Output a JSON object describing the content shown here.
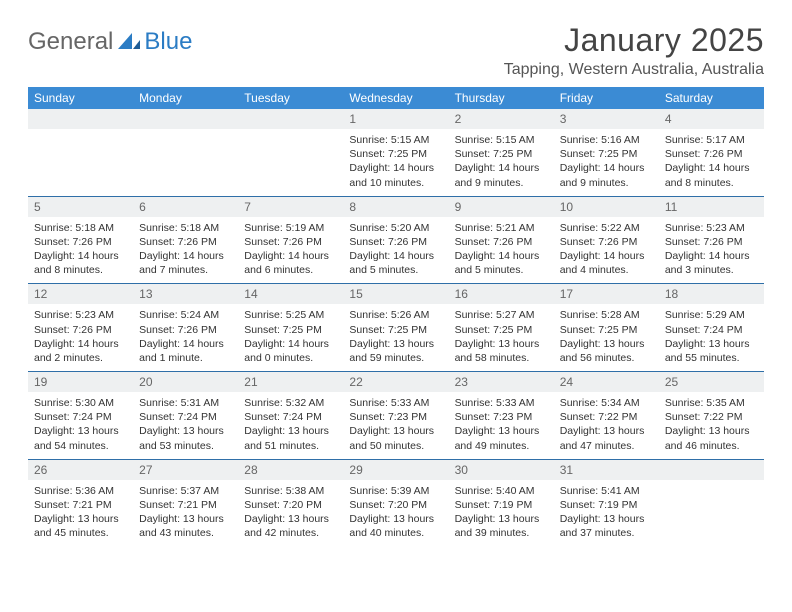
{
  "logo": {
    "part1": "General",
    "part2": "Blue"
  },
  "title": "January 2025",
  "location": "Tapping, Western Australia, Australia",
  "weekdays": [
    "Sunday",
    "Monday",
    "Tuesday",
    "Wednesday",
    "Thursday",
    "Friday",
    "Saturday"
  ],
  "weeks": [
    {
      "nums": [
        "",
        "",
        "",
        "1",
        "2",
        "3",
        "4"
      ],
      "cells": [
        null,
        null,
        null,
        {
          "sr": "Sunrise: 5:15 AM",
          "ss": "Sunset: 7:25 PM",
          "d1": "Daylight: 14 hours",
          "d2": "and 10 minutes."
        },
        {
          "sr": "Sunrise: 5:15 AM",
          "ss": "Sunset: 7:25 PM",
          "d1": "Daylight: 14 hours",
          "d2": "and 9 minutes."
        },
        {
          "sr": "Sunrise: 5:16 AM",
          "ss": "Sunset: 7:25 PM",
          "d1": "Daylight: 14 hours",
          "d2": "and 9 minutes."
        },
        {
          "sr": "Sunrise: 5:17 AM",
          "ss": "Sunset: 7:26 PM",
          "d1": "Daylight: 14 hours",
          "d2": "and 8 minutes."
        }
      ]
    },
    {
      "nums": [
        "5",
        "6",
        "7",
        "8",
        "9",
        "10",
        "11"
      ],
      "cells": [
        {
          "sr": "Sunrise: 5:18 AM",
          "ss": "Sunset: 7:26 PM",
          "d1": "Daylight: 14 hours",
          "d2": "and 8 minutes."
        },
        {
          "sr": "Sunrise: 5:18 AM",
          "ss": "Sunset: 7:26 PM",
          "d1": "Daylight: 14 hours",
          "d2": "and 7 minutes."
        },
        {
          "sr": "Sunrise: 5:19 AM",
          "ss": "Sunset: 7:26 PM",
          "d1": "Daylight: 14 hours",
          "d2": "and 6 minutes."
        },
        {
          "sr": "Sunrise: 5:20 AM",
          "ss": "Sunset: 7:26 PM",
          "d1": "Daylight: 14 hours",
          "d2": "and 5 minutes."
        },
        {
          "sr": "Sunrise: 5:21 AM",
          "ss": "Sunset: 7:26 PM",
          "d1": "Daylight: 14 hours",
          "d2": "and 5 minutes."
        },
        {
          "sr": "Sunrise: 5:22 AM",
          "ss": "Sunset: 7:26 PM",
          "d1": "Daylight: 14 hours",
          "d2": "and 4 minutes."
        },
        {
          "sr": "Sunrise: 5:23 AM",
          "ss": "Sunset: 7:26 PM",
          "d1": "Daylight: 14 hours",
          "d2": "and 3 minutes."
        }
      ]
    },
    {
      "nums": [
        "12",
        "13",
        "14",
        "15",
        "16",
        "17",
        "18"
      ],
      "cells": [
        {
          "sr": "Sunrise: 5:23 AM",
          "ss": "Sunset: 7:26 PM",
          "d1": "Daylight: 14 hours",
          "d2": "and 2 minutes."
        },
        {
          "sr": "Sunrise: 5:24 AM",
          "ss": "Sunset: 7:26 PM",
          "d1": "Daylight: 14 hours",
          "d2": "and 1 minute."
        },
        {
          "sr": "Sunrise: 5:25 AM",
          "ss": "Sunset: 7:25 PM",
          "d1": "Daylight: 14 hours",
          "d2": "and 0 minutes."
        },
        {
          "sr": "Sunrise: 5:26 AM",
          "ss": "Sunset: 7:25 PM",
          "d1": "Daylight: 13 hours",
          "d2": "and 59 minutes."
        },
        {
          "sr": "Sunrise: 5:27 AM",
          "ss": "Sunset: 7:25 PM",
          "d1": "Daylight: 13 hours",
          "d2": "and 58 minutes."
        },
        {
          "sr": "Sunrise: 5:28 AM",
          "ss": "Sunset: 7:25 PM",
          "d1": "Daylight: 13 hours",
          "d2": "and 56 minutes."
        },
        {
          "sr": "Sunrise: 5:29 AM",
          "ss": "Sunset: 7:24 PM",
          "d1": "Daylight: 13 hours",
          "d2": "and 55 minutes."
        }
      ]
    },
    {
      "nums": [
        "19",
        "20",
        "21",
        "22",
        "23",
        "24",
        "25"
      ],
      "cells": [
        {
          "sr": "Sunrise: 5:30 AM",
          "ss": "Sunset: 7:24 PM",
          "d1": "Daylight: 13 hours",
          "d2": "and 54 minutes."
        },
        {
          "sr": "Sunrise: 5:31 AM",
          "ss": "Sunset: 7:24 PM",
          "d1": "Daylight: 13 hours",
          "d2": "and 53 minutes."
        },
        {
          "sr": "Sunrise: 5:32 AM",
          "ss": "Sunset: 7:24 PM",
          "d1": "Daylight: 13 hours",
          "d2": "and 51 minutes."
        },
        {
          "sr": "Sunrise: 5:33 AM",
          "ss": "Sunset: 7:23 PM",
          "d1": "Daylight: 13 hours",
          "d2": "and 50 minutes."
        },
        {
          "sr": "Sunrise: 5:33 AM",
          "ss": "Sunset: 7:23 PM",
          "d1": "Daylight: 13 hours",
          "d2": "and 49 minutes."
        },
        {
          "sr": "Sunrise: 5:34 AM",
          "ss": "Sunset: 7:22 PM",
          "d1": "Daylight: 13 hours",
          "d2": "and 47 minutes."
        },
        {
          "sr": "Sunrise: 5:35 AM",
          "ss": "Sunset: 7:22 PM",
          "d1": "Daylight: 13 hours",
          "d2": "and 46 minutes."
        }
      ]
    },
    {
      "nums": [
        "26",
        "27",
        "28",
        "29",
        "30",
        "31",
        ""
      ],
      "cells": [
        {
          "sr": "Sunrise: 5:36 AM",
          "ss": "Sunset: 7:21 PM",
          "d1": "Daylight: 13 hours",
          "d2": "and 45 minutes."
        },
        {
          "sr": "Sunrise: 5:37 AM",
          "ss": "Sunset: 7:21 PM",
          "d1": "Daylight: 13 hours",
          "d2": "and 43 minutes."
        },
        {
          "sr": "Sunrise: 5:38 AM",
          "ss": "Sunset: 7:20 PM",
          "d1": "Daylight: 13 hours",
          "d2": "and 42 minutes."
        },
        {
          "sr": "Sunrise: 5:39 AM",
          "ss": "Sunset: 7:20 PM",
          "d1": "Daylight: 13 hours",
          "d2": "and 40 minutes."
        },
        {
          "sr": "Sunrise: 5:40 AM",
          "ss": "Sunset: 7:19 PM",
          "d1": "Daylight: 13 hours",
          "d2": "and 39 minutes."
        },
        {
          "sr": "Sunrise: 5:41 AM",
          "ss": "Sunset: 7:19 PM",
          "d1": "Daylight: 13 hours",
          "d2": "and 37 minutes."
        },
        null
      ]
    }
  ],
  "chart_data": {
    "type": "table",
    "title": "January 2025 — Sunrise, Sunset, Daylight — Tapping, Western Australia, Australia",
    "columns": [
      "day",
      "sunrise",
      "sunset",
      "daylight_minutes"
    ],
    "rows": [
      [
        1,
        "5:15 AM",
        "7:25 PM",
        850
      ],
      [
        2,
        "5:15 AM",
        "7:25 PM",
        849
      ],
      [
        3,
        "5:16 AM",
        "7:25 PM",
        849
      ],
      [
        4,
        "5:17 AM",
        "7:26 PM",
        848
      ],
      [
        5,
        "5:18 AM",
        "7:26 PM",
        848
      ],
      [
        6,
        "5:18 AM",
        "7:26 PM",
        847
      ],
      [
        7,
        "5:19 AM",
        "7:26 PM",
        846
      ],
      [
        8,
        "5:20 AM",
        "7:26 PM",
        845
      ],
      [
        9,
        "5:21 AM",
        "7:26 PM",
        845
      ],
      [
        10,
        "5:22 AM",
        "7:26 PM",
        844
      ],
      [
        11,
        "5:23 AM",
        "7:26 PM",
        843
      ],
      [
        12,
        "5:23 AM",
        "7:26 PM",
        842
      ],
      [
        13,
        "5:24 AM",
        "7:26 PM",
        841
      ],
      [
        14,
        "5:25 AM",
        "7:25 PM",
        840
      ],
      [
        15,
        "5:26 AM",
        "7:25 PM",
        839
      ],
      [
        16,
        "5:27 AM",
        "7:25 PM",
        838
      ],
      [
        17,
        "5:28 AM",
        "7:25 PM",
        836
      ],
      [
        18,
        "5:29 AM",
        "7:24 PM",
        835
      ],
      [
        19,
        "5:30 AM",
        "7:24 PM",
        834
      ],
      [
        20,
        "5:31 AM",
        "7:24 PM",
        833
      ],
      [
        21,
        "5:32 AM",
        "7:24 PM",
        831
      ],
      [
        22,
        "5:33 AM",
        "7:23 PM",
        830
      ],
      [
        23,
        "5:33 AM",
        "7:23 PM",
        829
      ],
      [
        24,
        "5:34 AM",
        "7:22 PM",
        827
      ],
      [
        25,
        "5:35 AM",
        "7:22 PM",
        826
      ],
      [
        26,
        "5:36 AM",
        "7:21 PM",
        825
      ],
      [
        27,
        "5:37 AM",
        "7:21 PM",
        823
      ],
      [
        28,
        "5:38 AM",
        "7:20 PM",
        822
      ],
      [
        29,
        "5:39 AM",
        "7:20 PM",
        820
      ],
      [
        30,
        "5:40 AM",
        "7:19 PM",
        819
      ],
      [
        31,
        "5:41 AM",
        "7:19 PM",
        817
      ]
    ]
  }
}
